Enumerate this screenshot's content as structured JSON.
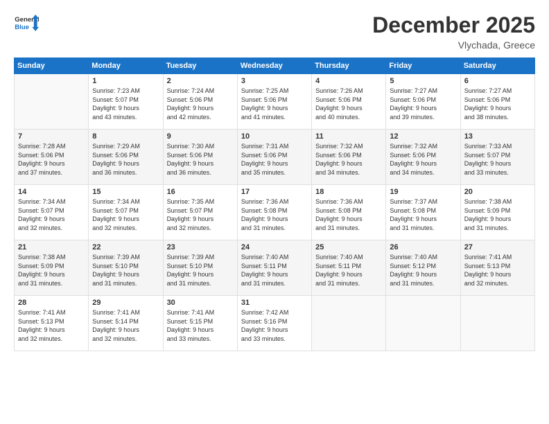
{
  "header": {
    "logo_line1": "General",
    "logo_line2": "Blue",
    "month": "December 2025",
    "location": "Vlychada, Greece"
  },
  "days_of_week": [
    "Sunday",
    "Monday",
    "Tuesday",
    "Wednesday",
    "Thursday",
    "Friday",
    "Saturday"
  ],
  "weeks": [
    [
      {
        "num": "",
        "text": ""
      },
      {
        "num": "1",
        "text": "Sunrise: 7:23 AM\nSunset: 5:07 PM\nDaylight: 9 hours\nand 43 minutes."
      },
      {
        "num": "2",
        "text": "Sunrise: 7:24 AM\nSunset: 5:06 PM\nDaylight: 9 hours\nand 42 minutes."
      },
      {
        "num": "3",
        "text": "Sunrise: 7:25 AM\nSunset: 5:06 PM\nDaylight: 9 hours\nand 41 minutes."
      },
      {
        "num": "4",
        "text": "Sunrise: 7:26 AM\nSunset: 5:06 PM\nDaylight: 9 hours\nand 40 minutes."
      },
      {
        "num": "5",
        "text": "Sunrise: 7:27 AM\nSunset: 5:06 PM\nDaylight: 9 hours\nand 39 minutes."
      },
      {
        "num": "6",
        "text": "Sunrise: 7:27 AM\nSunset: 5:06 PM\nDaylight: 9 hours\nand 38 minutes."
      }
    ],
    [
      {
        "num": "7",
        "text": "Sunrise: 7:28 AM\nSunset: 5:06 PM\nDaylight: 9 hours\nand 37 minutes."
      },
      {
        "num": "8",
        "text": "Sunrise: 7:29 AM\nSunset: 5:06 PM\nDaylight: 9 hours\nand 36 minutes."
      },
      {
        "num": "9",
        "text": "Sunrise: 7:30 AM\nSunset: 5:06 PM\nDaylight: 9 hours\nand 36 minutes."
      },
      {
        "num": "10",
        "text": "Sunrise: 7:31 AM\nSunset: 5:06 PM\nDaylight: 9 hours\nand 35 minutes."
      },
      {
        "num": "11",
        "text": "Sunrise: 7:32 AM\nSunset: 5:06 PM\nDaylight: 9 hours\nand 34 minutes."
      },
      {
        "num": "12",
        "text": "Sunrise: 7:32 AM\nSunset: 5:06 PM\nDaylight: 9 hours\nand 34 minutes."
      },
      {
        "num": "13",
        "text": "Sunrise: 7:33 AM\nSunset: 5:07 PM\nDaylight: 9 hours\nand 33 minutes."
      }
    ],
    [
      {
        "num": "14",
        "text": "Sunrise: 7:34 AM\nSunset: 5:07 PM\nDaylight: 9 hours\nand 32 minutes."
      },
      {
        "num": "15",
        "text": "Sunrise: 7:34 AM\nSunset: 5:07 PM\nDaylight: 9 hours\nand 32 minutes."
      },
      {
        "num": "16",
        "text": "Sunrise: 7:35 AM\nSunset: 5:07 PM\nDaylight: 9 hours\nand 32 minutes."
      },
      {
        "num": "17",
        "text": "Sunrise: 7:36 AM\nSunset: 5:08 PM\nDaylight: 9 hours\nand 31 minutes."
      },
      {
        "num": "18",
        "text": "Sunrise: 7:36 AM\nSunset: 5:08 PM\nDaylight: 9 hours\nand 31 minutes."
      },
      {
        "num": "19",
        "text": "Sunrise: 7:37 AM\nSunset: 5:08 PM\nDaylight: 9 hours\nand 31 minutes."
      },
      {
        "num": "20",
        "text": "Sunrise: 7:38 AM\nSunset: 5:09 PM\nDaylight: 9 hours\nand 31 minutes."
      }
    ],
    [
      {
        "num": "21",
        "text": "Sunrise: 7:38 AM\nSunset: 5:09 PM\nDaylight: 9 hours\nand 31 minutes."
      },
      {
        "num": "22",
        "text": "Sunrise: 7:39 AM\nSunset: 5:10 PM\nDaylight: 9 hours\nand 31 minutes."
      },
      {
        "num": "23",
        "text": "Sunrise: 7:39 AM\nSunset: 5:10 PM\nDaylight: 9 hours\nand 31 minutes."
      },
      {
        "num": "24",
        "text": "Sunrise: 7:40 AM\nSunset: 5:11 PM\nDaylight: 9 hours\nand 31 minutes."
      },
      {
        "num": "25",
        "text": "Sunrise: 7:40 AM\nSunset: 5:11 PM\nDaylight: 9 hours\nand 31 minutes."
      },
      {
        "num": "26",
        "text": "Sunrise: 7:40 AM\nSunset: 5:12 PM\nDaylight: 9 hours\nand 31 minutes."
      },
      {
        "num": "27",
        "text": "Sunrise: 7:41 AM\nSunset: 5:13 PM\nDaylight: 9 hours\nand 32 minutes."
      }
    ],
    [
      {
        "num": "28",
        "text": "Sunrise: 7:41 AM\nSunset: 5:13 PM\nDaylight: 9 hours\nand 32 minutes."
      },
      {
        "num": "29",
        "text": "Sunrise: 7:41 AM\nSunset: 5:14 PM\nDaylight: 9 hours\nand 32 minutes."
      },
      {
        "num": "30",
        "text": "Sunrise: 7:41 AM\nSunset: 5:15 PM\nDaylight: 9 hours\nand 33 minutes."
      },
      {
        "num": "31",
        "text": "Sunrise: 7:42 AM\nSunset: 5:16 PM\nDaylight: 9 hours\nand 33 minutes."
      },
      {
        "num": "",
        "text": ""
      },
      {
        "num": "",
        "text": ""
      },
      {
        "num": "",
        "text": ""
      }
    ]
  ]
}
